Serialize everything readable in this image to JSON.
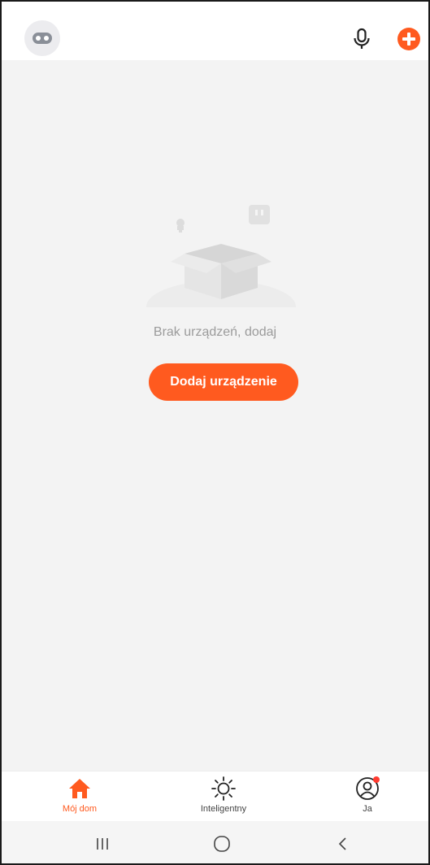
{
  "empty_state": {
    "message": "Brak urządzeń, dodaj",
    "button_label": "Dodaj urządzenie"
  },
  "tabs": [
    {
      "label": "Mój dom",
      "icon": "home-icon",
      "active": true
    },
    {
      "label": "Inteligentny",
      "icon": "sun-icon",
      "active": false
    },
    {
      "label": "Ja",
      "icon": "profile-icon",
      "active": false
    }
  ],
  "colors": {
    "accent": "#ff5a1f",
    "background": "#f3f3f3",
    "notification_dot": "#ff3b30"
  },
  "icons": {
    "top_left": "robot-avatar-icon",
    "top_right": [
      "microphone-icon",
      "add-circle-icon"
    ],
    "system_nav": [
      "recent-apps-icon",
      "home-circle-icon",
      "back-icon"
    ]
  }
}
